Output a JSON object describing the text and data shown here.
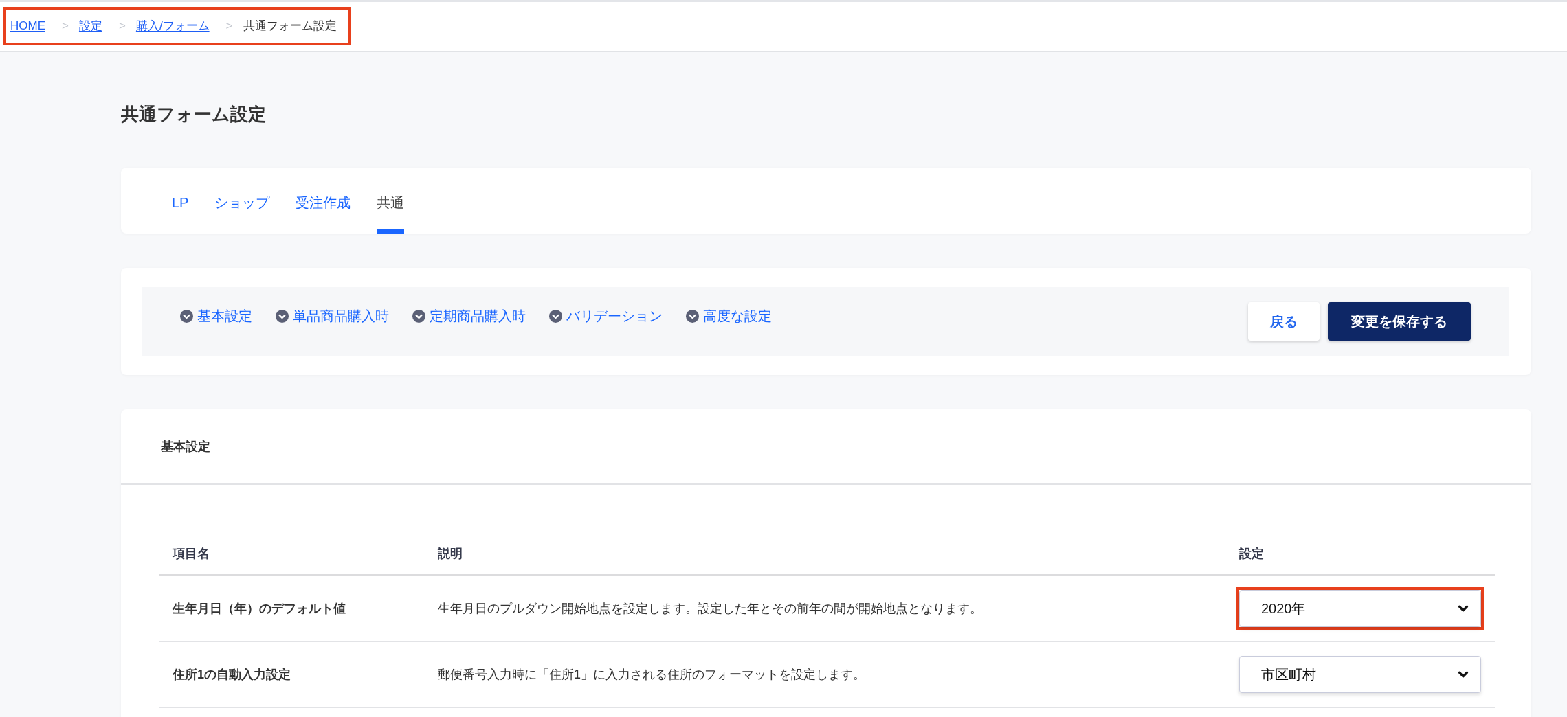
{
  "breadcrumb": {
    "highlighted": true,
    "items": [
      {
        "label": "HOME",
        "kind": "link"
      },
      {
        "label": "設定",
        "kind": "link",
        "separator": ">"
      },
      {
        "label": "購入/フォーム",
        "kind": "link",
        "separator": ">"
      },
      {
        "label": "共通フォーム設定",
        "kind": "current",
        "separator": ">"
      }
    ]
  },
  "page_title": "共通フォーム設定",
  "tabs": [
    {
      "label": "LP",
      "selected": false
    },
    {
      "label": "ショップ",
      "selected": false
    },
    {
      "label": "受注作成",
      "selected": false
    },
    {
      "label": "共通",
      "selected": true
    }
  ],
  "section_links": [
    "基本設定",
    "単品商品購入時",
    "定期商品購入時",
    "バリデーション",
    "高度な設定"
  ],
  "buttons": [
    {
      "label": "戻る",
      "kind": "secondary"
    },
    {
      "label": "変更を保存する",
      "kind": "primary"
    }
  ],
  "section": {
    "title": "基本設定",
    "table": {
      "columns": [
        "項目名",
        "説明",
        "設定"
      ],
      "rows": [
        {
          "name": "生年月日（年）のデフォルト値",
          "description": "生年月日のプルダウン開始地点を設定します。設定した年とその前年の間が開始地点となります。",
          "setting": {
            "value": "2020年",
            "highlighted": true
          }
        },
        {
          "name": "住所1の自動入力設定",
          "description": "郵便番号入力時に「住所1」に入力される住所のフォーマットを設定します。",
          "setting": {
            "value": "市区町村",
            "highlighted": false
          }
        }
      ]
    }
  }
}
